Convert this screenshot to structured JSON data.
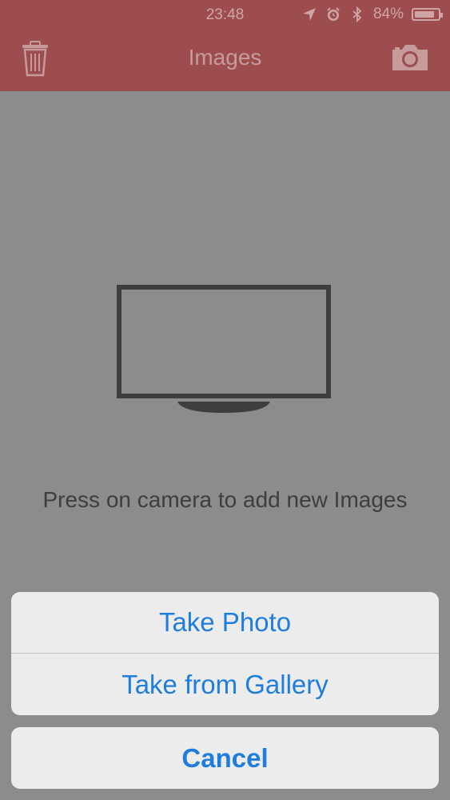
{
  "status_bar": {
    "time": "23:48",
    "icons": [
      "location-arrow-icon",
      "alarm-clock-icon",
      "bluetooth-icon"
    ],
    "battery_percent": "84%",
    "battery_level": 0.84
  },
  "nav": {
    "title": "Images",
    "left_icon": "trash-icon",
    "right_icon": "camera-icon"
  },
  "empty_state": {
    "icon": "tv-monitor-icon",
    "message": "Press on camera to add new Images"
  },
  "action_sheet": {
    "options": [
      "Take Photo",
      "Take from Gallery"
    ],
    "cancel": "Cancel"
  },
  "colors": {
    "header_bg": "#9e4d4f",
    "dim_bg": "#8c8c8c",
    "action_text": "#1f7de0",
    "sheet_bg": "#ececec"
  }
}
